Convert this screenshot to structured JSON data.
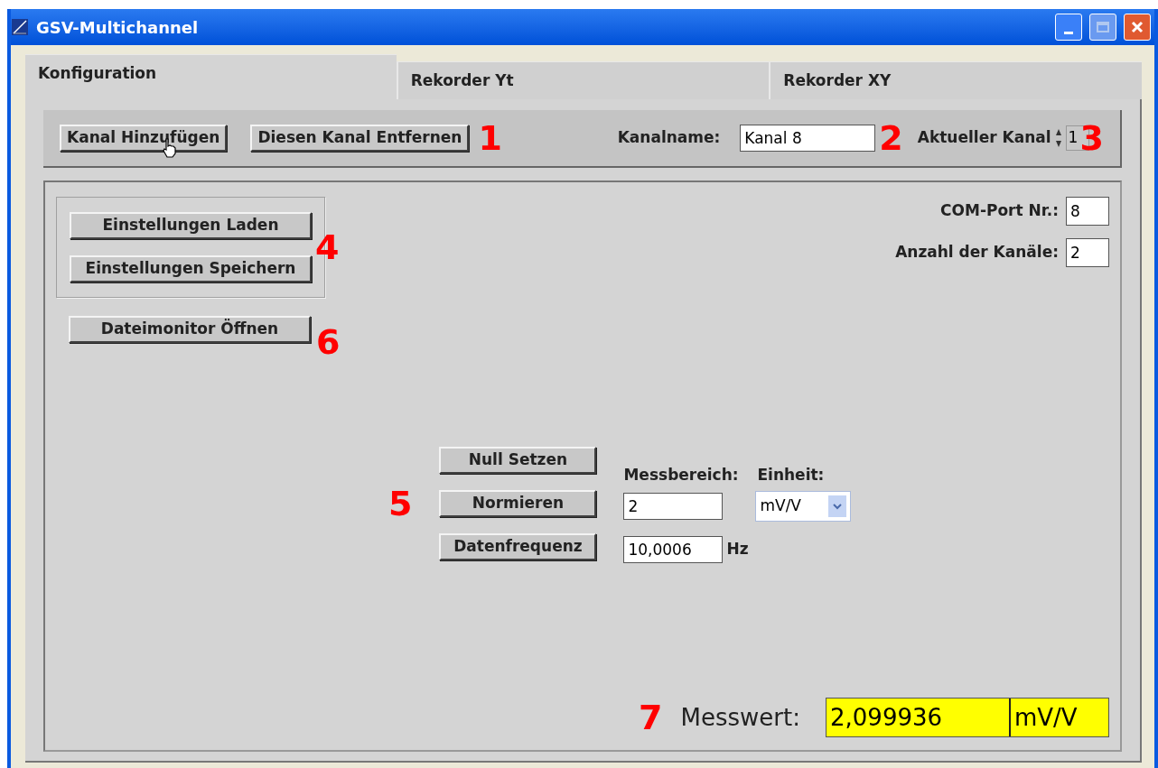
{
  "window": {
    "title": "GSV-Multichannel"
  },
  "tabs": [
    {
      "label": "Konfiguration",
      "selected": true
    },
    {
      "label": "Rekorder Yt",
      "selected": false
    },
    {
      "label": "Rekorder XY",
      "selected": false
    }
  ],
  "toolbar": {
    "buttons": [
      {
        "label": "Kanal Hinzufügen"
      },
      {
        "label": "Diesen Kanal Entfernen"
      }
    ],
    "callout_buttons": "1",
    "channel_name": {
      "label": "Kanalname:",
      "value": "Kanal 8"
    },
    "callout_name": "2",
    "current_channel": {
      "label": "Aktueller Kanal",
      "value": "1"
    },
    "callout_current": "3"
  },
  "settings_group": {
    "buttons": [
      {
        "label": "Einstellungen Laden"
      },
      {
        "label": "Einstellungen Speichern"
      }
    ],
    "callout": "4"
  },
  "file_monitor": {
    "label": "Dateimonitor Öffnen",
    "callout": "6"
  },
  "port_fields": [
    {
      "label": "COM-Port Nr.:",
      "value": "8"
    },
    {
      "label": "Anzahl der Kanäle:",
      "value": "2"
    }
  ],
  "measurement": {
    "callout": "5",
    "buttons": [
      {
        "label": "Null Setzen"
      },
      {
        "label": "Normieren"
      },
      {
        "label": "Datenfrequenz"
      }
    ],
    "range_label": "Messbereich:",
    "range_value": "2",
    "unit_label": "Einheit:",
    "unit_value": "mV/V",
    "frequency_value": "10,0006",
    "frequency_unit": "Hz"
  },
  "reading": {
    "callout": "7",
    "label": "Messwert:",
    "value": "2,099936",
    "unit": "mV/V"
  }
}
